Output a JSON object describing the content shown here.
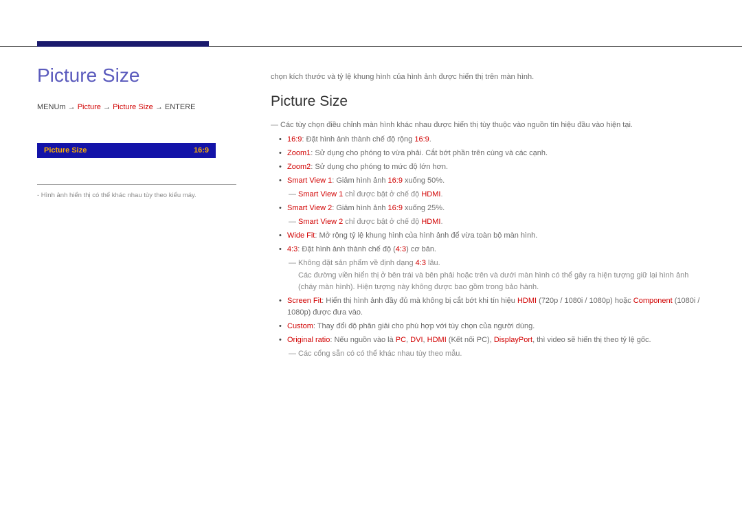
{
  "left": {
    "title": "Picture Size",
    "path": {
      "menu": "MENU",
      "m_glyph": "m",
      "arrow": " → ",
      "p1": "Picture",
      "p2": "Picture Size",
      "enter": "ENTER",
      "e_glyph": "E"
    },
    "osd": {
      "label": "Picture Size",
      "value": "16:9"
    },
    "footnote": "- Hình ảnh hiển thị có thể khác nhau tùy theo kiểu máy."
  },
  "right": {
    "intro": "chọn kích thước và tỷ lệ khung hình của hình ảnh được hiển thị trên màn hình.",
    "heading": "Picture Size",
    "sub1": "Các tùy chọn điều chỉnh màn hình khác nhau được hiển thị tùy thuộc vào nguồn tín hiệu đầu vào hiện tại.",
    "items": [
      {
        "type": "bullet",
        "red": "16:9",
        "rest": ": Đặt hình ảnh thành chế độ rộng ",
        "red2": "16:9",
        "tail": "."
      },
      {
        "type": "bullet",
        "red": "Zoom1",
        "rest": ": Sử dụng cho phóng to vừa phải. Cắt bớt phần trên cùng và các cạnh."
      },
      {
        "type": "bullet",
        "red": "Zoom2",
        "rest": ": Sử dụng cho phóng to mức độ lớn hơn."
      },
      {
        "type": "bullet",
        "red": "Smart View 1",
        "rest": ": Giảm hình ảnh ",
        "red2": "16:9",
        "tail": " xuống 50%."
      },
      {
        "type": "dash",
        "red": "Smart View 1",
        "gray": " chỉ được bật ở chế độ ",
        "red2": "HDMI",
        "gtail": "."
      },
      {
        "type": "bullet",
        "red": "Smart View 2",
        "rest": ": Giảm hình ảnh ",
        "red2": "16:9",
        "tail": " xuống 25%."
      },
      {
        "type": "dash",
        "red": "Smart View 2",
        "gray": " chỉ được bật ở chế độ ",
        "red2": "HDMI",
        "gtail": "."
      },
      {
        "type": "bullet",
        "red": "Wide Fit",
        "rest": ": Mở rộng tỷ lệ khung hình của hình ảnh để vừa toàn bộ màn hình."
      },
      {
        "type": "bullet",
        "red": "4:3",
        "rest": ": Đặt hình ảnh thành chế độ (",
        "red2": "4:3",
        "tail": ") cơ bản."
      },
      {
        "type": "dash_multi",
        "gray1": "Không đặt sản phẩm về định dạng ",
        "red1": "4:3",
        "gray2": " lâu.\nCác đường viền hiển thị ở bên trái và bên phải hoặc trên và dưới màn hình có thể gây ra hiện tượng giữ lại hình ảnh (cháy màn hình). Hiện tượng này không được bao gồm trong bảo hành."
      },
      {
        "type": "bullet_multi",
        "red": "Screen Fit",
        "rest": ": Hiển thị hình ảnh đầy đủ mà không bị cắt bớt khi tín hiệu ",
        "red2": "HDMI",
        "rest2": " (720p / 1080i / 1080p) hoặc ",
        "red3": "Component",
        "rest3": " (1080i / 1080p) được đưa vào."
      },
      {
        "type": "bullet",
        "red": "Custom",
        "rest": ": Thay đổi độ phân giải cho phù hợp với tùy chọn của người dùng."
      },
      {
        "type": "bullet_orig",
        "red": "Original ratio",
        "rest": ": Nếu nguồn vào là ",
        "red2": "PC",
        "rest2": ", ",
        "red3": "DVI",
        "rest3": ", ",
        "red4": "HDMI",
        "rest4": " (Kết nối PC), ",
        "red5": "DisplayPort",
        "rest5": ", thì video sẽ hiển thị theo tỷ lệ gốc."
      },
      {
        "type": "dash",
        "gray": "Các cổng sẵn có có thể khác nhau tùy theo mẫu."
      }
    ]
  }
}
